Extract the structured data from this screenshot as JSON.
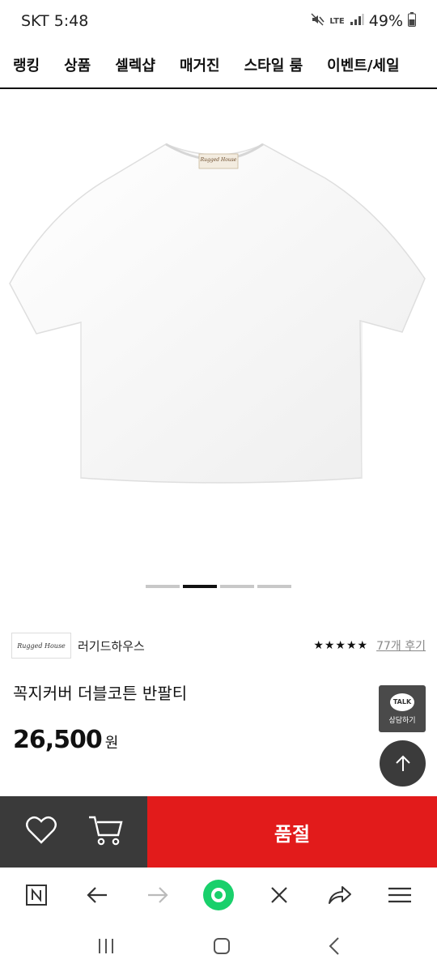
{
  "status": {
    "carrier_time": "SKT 5:48",
    "network": "LTE",
    "battery": "49%"
  },
  "nav": {
    "items": [
      "랭킹",
      "상품",
      "셀렉샵",
      "매거진",
      "스타일 룸",
      "이벤트/세일"
    ]
  },
  "product": {
    "image_alt": "white short-sleeve t-shirt",
    "label_text": "Rugged House",
    "carousel": {
      "count": 4,
      "active_index": 1
    }
  },
  "brand": {
    "logo_text": "Rugged House",
    "name": "러기드하우스"
  },
  "rating": {
    "stars": 5,
    "reviews_label": "77개 후기"
  },
  "title": "꼭지커버 더블코튼 반팔티",
  "price": {
    "amount": "26,500",
    "unit": "원"
  },
  "floating": {
    "talk_bubble": "TALK",
    "talk_label": "상담하기"
  },
  "bottom_bar": {
    "buy_label": "품절"
  },
  "colors": {
    "sold_out": "#e21b1b",
    "dark": "#3a3a3a"
  }
}
